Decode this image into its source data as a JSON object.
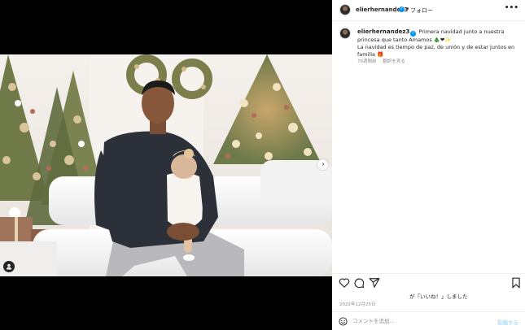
{
  "post": {
    "username": "elierhernandez3",
    "separator": "•",
    "follow_label": "フォロー",
    "more_label": "•••",
    "image_alt": "Man holding a baby in front of decorated Christmas trees"
  },
  "caption": {
    "username": "elierhernandez3",
    "line1": "Primera navidad junto a nuestra princesa que tanto Amamos 🎄❤✨",
    "line2": "La navidad es tiempo de paz, de unión y de estar juntos en familia 🎁",
    "age": "76週間前",
    "translate_label": "翻訳を見る"
  },
  "footer": {
    "likes_text": "が「いいね！」しました",
    "date": "2022年12月25日",
    "comment_placeholder": "コメントを追加...",
    "post_label": "投稿する"
  },
  "colors": {
    "accent": "#0095f6",
    "text": "#262626",
    "muted": "#8e8e8e"
  },
  "icons": {
    "heart": "heart-icon",
    "comment": "comment-icon",
    "share": "share-icon",
    "save": "bookmark-icon",
    "emoji": "emoji-icon",
    "next": "chevron-right-icon",
    "tag": "user-tag-icon"
  }
}
